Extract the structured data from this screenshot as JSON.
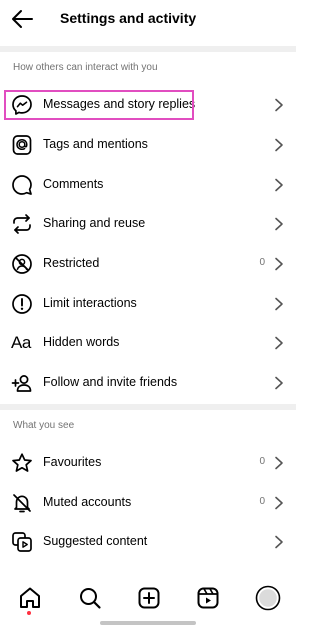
{
  "header": {
    "title": "Settings and activity"
  },
  "sections": {
    "interact": {
      "title": "How others can interact with you",
      "items": [
        {
          "label": "Messages and story replies",
          "icon": "messenger-icon",
          "count": ""
        },
        {
          "label": "Tags and mentions",
          "icon": "at-sign-icon",
          "count": ""
        },
        {
          "label": "Comments",
          "icon": "comment-icon",
          "count": ""
        },
        {
          "label": "Sharing and reuse",
          "icon": "share-reuse-icon",
          "count": ""
        },
        {
          "label": "Restricted",
          "icon": "restricted-icon",
          "count": "0"
        },
        {
          "label": "Limit interactions",
          "icon": "limit-icon",
          "count": ""
        },
        {
          "label": "Hidden words",
          "icon": "hidden-words-icon",
          "count": "",
          "glyph": "Aa"
        },
        {
          "label": "Follow and invite friends",
          "icon": "add-person-icon",
          "count": ""
        }
      ]
    },
    "see": {
      "title": "What you see",
      "items": [
        {
          "label": "Favourites",
          "icon": "star-icon",
          "count": "0"
        },
        {
          "label": "Muted accounts",
          "icon": "muted-bell-icon",
          "count": "0"
        },
        {
          "label": "Suggested content",
          "icon": "suggested-content-icon",
          "count": ""
        }
      ]
    }
  },
  "bottom_nav": [
    "home-icon",
    "search-icon",
    "create-icon",
    "reels-icon",
    "profile-avatar"
  ],
  "colors": {
    "highlight": "#e14dc0",
    "secondary_text": "#737373",
    "notification_dot": "#ff3040"
  }
}
